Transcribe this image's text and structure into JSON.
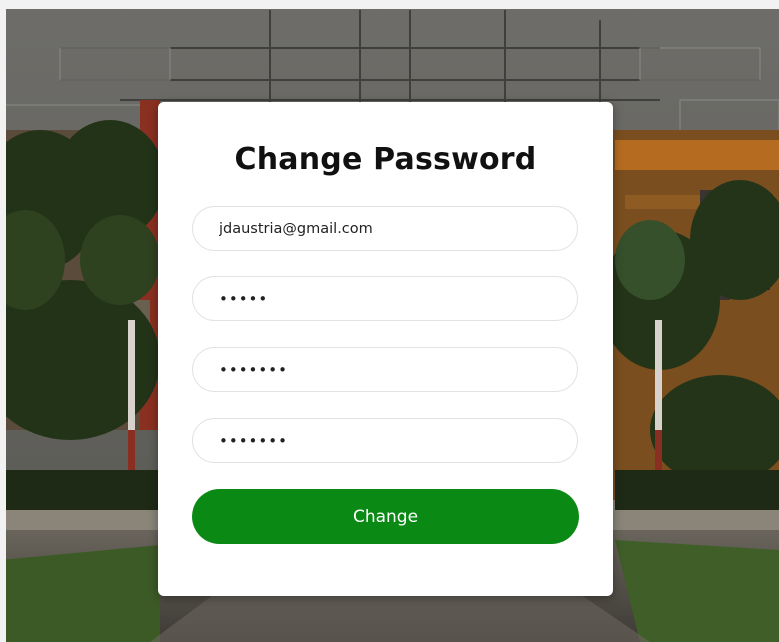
{
  "form": {
    "title": "Change Password",
    "email_value": "jdaustria@gmail.com",
    "current_password_value": "12345",
    "new_password_value": "1234567",
    "confirm_password_value": "1234567",
    "submit_label": "Change",
    "submit_color": "#0a8a14"
  }
}
